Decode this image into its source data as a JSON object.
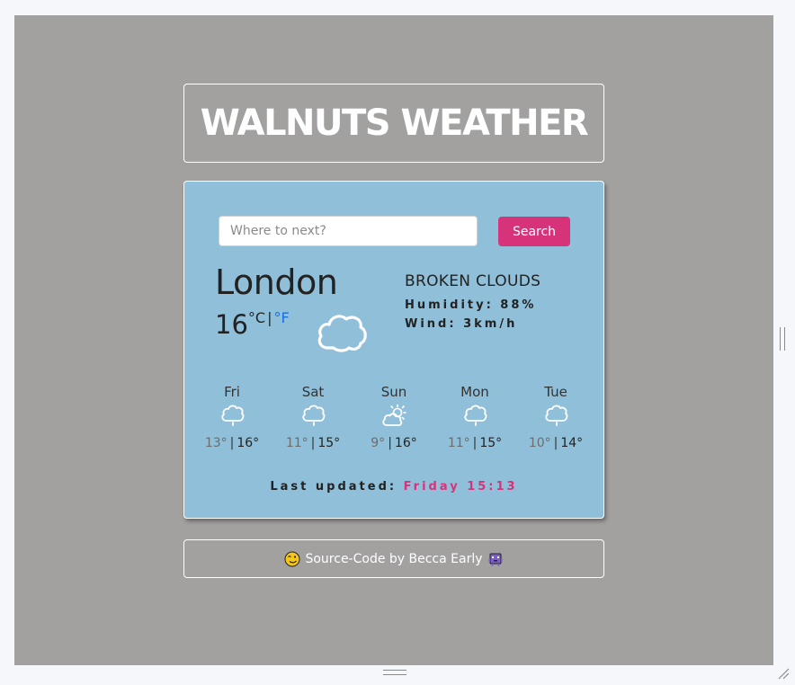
{
  "app": {
    "title": "WALNUTS WEATHER"
  },
  "search": {
    "placeholder": "Where to next?",
    "button_label": "Search"
  },
  "current": {
    "city": "London",
    "temperature": "16",
    "unit_c": "°C",
    "unit_separator": "|",
    "unit_f": "°F",
    "description": "BROKEN CLOUDS",
    "humidity": "Humidity: 88%",
    "wind": "Wind: 3km/h",
    "icon": "cloud-icon"
  },
  "forecast": [
    {
      "day": "Fri",
      "min": "13°",
      "max": "16°",
      "icon": "cloud-rain-icon"
    },
    {
      "day": "Sat",
      "min": "11°",
      "max": "15°",
      "icon": "cloud-rain-icon"
    },
    {
      "day": "Sun",
      "min": "9°",
      "max": "16°",
      "icon": "partly-cloudy-icon"
    },
    {
      "day": "Mon",
      "min": "11°",
      "max": "15°",
      "icon": "cloud-rain-icon"
    },
    {
      "day": "Tue",
      "min": "10°",
      "max": "14°",
      "icon": "cloud-rain-icon"
    }
  ],
  "forecast_separator": "|",
  "updated": {
    "label": "Last updated:",
    "time": "Friday 15:13"
  },
  "footer": {
    "text": "Source-Code by Becca Early",
    "left_icon": "wink-face-icon",
    "right_icon": "alien-monster-icon"
  },
  "colors": {
    "background": "#a3a0a0",
    "card": "#8fbfd9",
    "accent": "#d6337a",
    "fahrenheit_link": "#1a6fe0"
  }
}
